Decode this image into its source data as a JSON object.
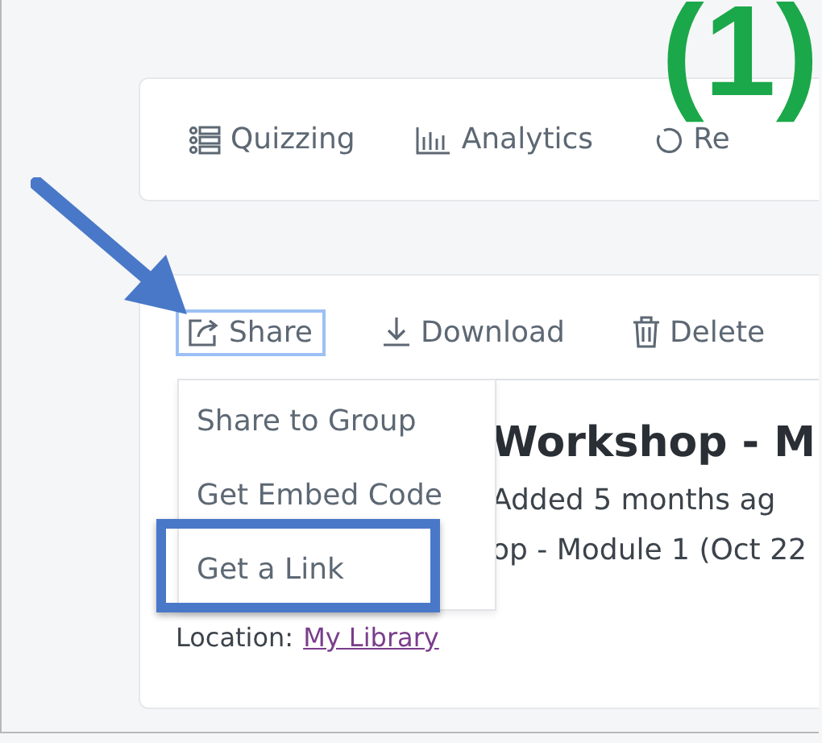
{
  "annotation": {
    "step_label": "(1)"
  },
  "nav_tabs": [
    {
      "label": "Quizzing"
    },
    {
      "label": "Analytics"
    },
    {
      "label": "Re"
    }
  ],
  "toolbar": [
    {
      "label": "Share",
      "selected": true
    },
    {
      "label": "Download",
      "selected": false
    },
    {
      "label": "Delete",
      "selected": false
    }
  ],
  "share_menu": [
    {
      "label": "Share to Group",
      "highlighted": false
    },
    {
      "label": "Get Embed Code",
      "highlighted": false
    },
    {
      "label": "Get a Link",
      "highlighted": true
    }
  ],
  "media": {
    "title": "Workshop - M",
    "added": "Added 5 months ag",
    "description": "op - Module 1 (Oct 22",
    "location_label": "Location:",
    "location_link": "My Library"
  }
}
